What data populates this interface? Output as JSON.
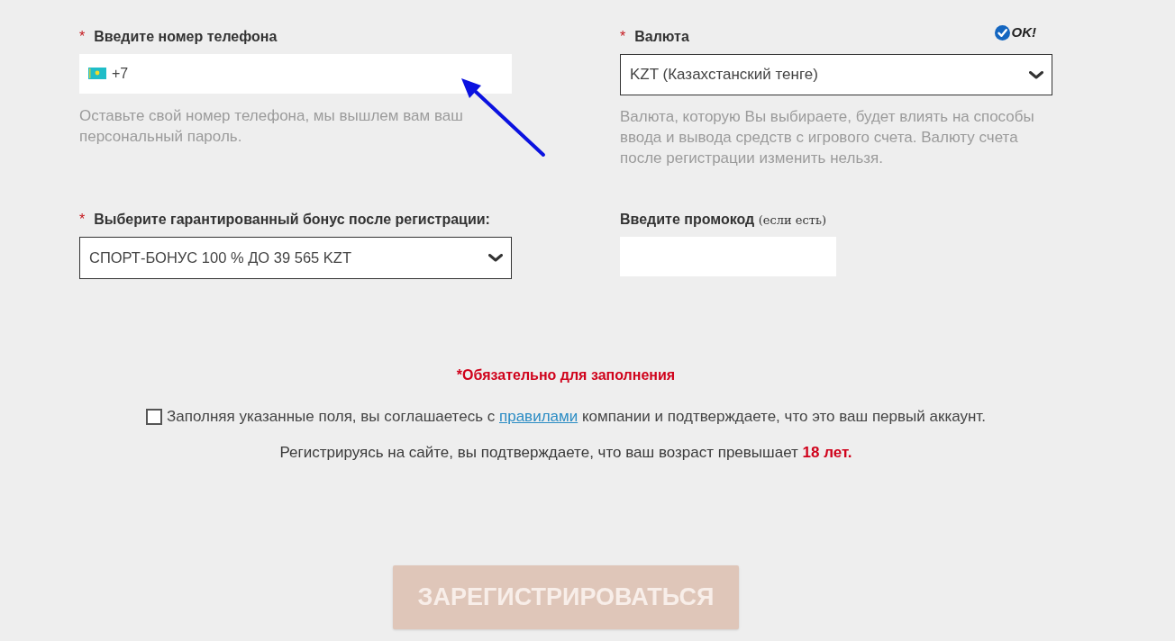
{
  "phone": {
    "required_mark": "*",
    "label": "Введите номер телефона",
    "value": "+7",
    "hint": "Оставьте свой номер телефона, мы вышлем вам ваш персональный пароль."
  },
  "currency": {
    "required_mark": "*",
    "label": "Валюта",
    "valid": true,
    "status_text": "OK!",
    "value": "KZT (Казахстанский тенге)",
    "hint": "Валюта, которую Вы выбираете, будет влиять на способы ввода и вывода средств с игрового счета. Валюту счета после регистрации изменить нельзя."
  },
  "bonus": {
    "required_mark": "*",
    "label": "Выберите гарантированный бонус после регистрации:",
    "value": "СПОРТ-БОНУС 100 % ДО 39 565 KZT"
  },
  "promo": {
    "label": "Введите промокод",
    "note": "(если есть)"
  },
  "required_note": "*Обязательно для заполнения",
  "agreement": {
    "checked": false,
    "text_before": "Заполняя указанные поля, вы соглашаетесь с",
    "link": "правилами",
    "text_after": "компании и подтверждаете, что это ваш первый аккаунт."
  },
  "age_notice": {
    "text": "Регистрируясь на сайте, вы подтверждаете, что ваш возраст превышает",
    "highlight": "18 лет."
  },
  "submit": {
    "label": "ЗАРЕГИСТРИРОВАТЬСЯ",
    "disabled": true
  }
}
